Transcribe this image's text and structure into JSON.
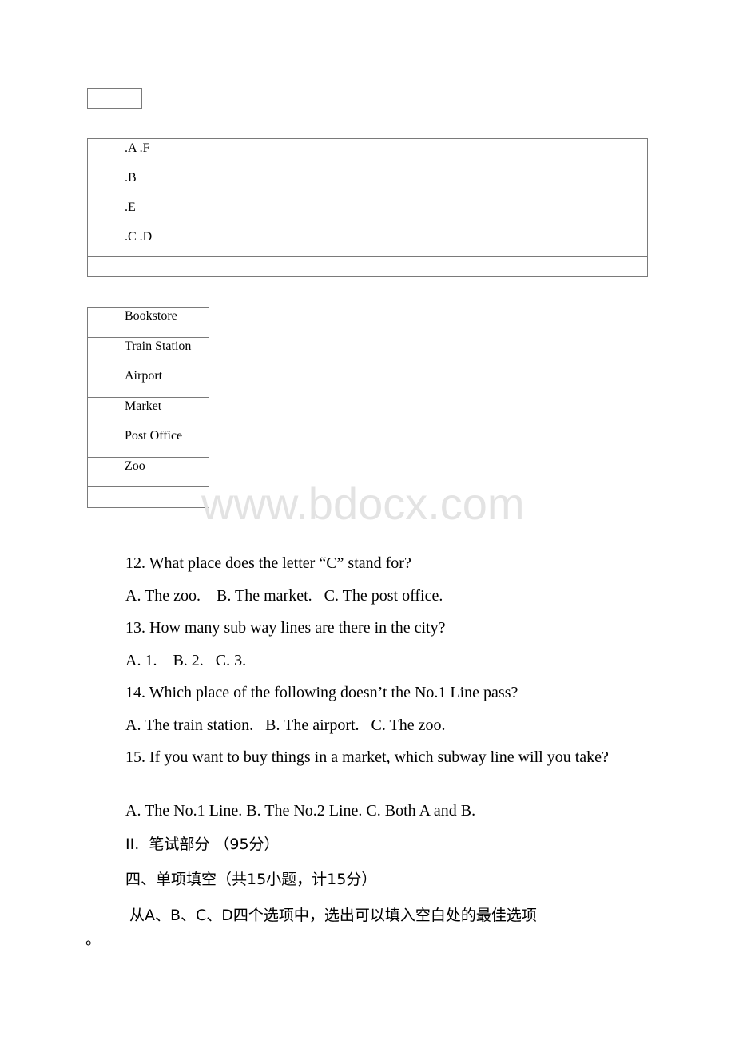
{
  "letters_table": {
    "lines": [
      ".A .F",
      ".B",
      ".E",
      ".C .D"
    ]
  },
  "places_table": {
    "rows": [
      "Bookstore",
      "Train Station",
      "Airport",
      "Market",
      "Post Office",
      "Zoo",
      ""
    ]
  },
  "watermark": "www.bdocx.com",
  "questions": [
    {
      "question": "12. What place does the letter “C” stand for?",
      "options": "A. The zoo.    B. The market.   C. The post office."
    },
    {
      "question": "13. How many sub way lines are there in the city?",
      "options": "A. 1.    B. 2.   C. 3."
    },
    {
      "question": "14. Which place of the following doesn’t the No.1 Line pass?",
      "options": "A. The train station.   B. The airport.   C. The zoo."
    },
    {
      "question": "15. If you want to buy things in a market, which subway line will you take?",
      "options": "A. The No.1 Line. B. The No.2 Line. C. Both A and B."
    }
  ],
  "section": {
    "part_heading": "II.  笔试部分 （95分）",
    "subsection_heading": "四、单项填空（共15小题，计15分）",
    "instruction": "从A、B、C、D四个选项中，选出可以填入空白处的最佳选项",
    "instruction_end": "。"
  }
}
